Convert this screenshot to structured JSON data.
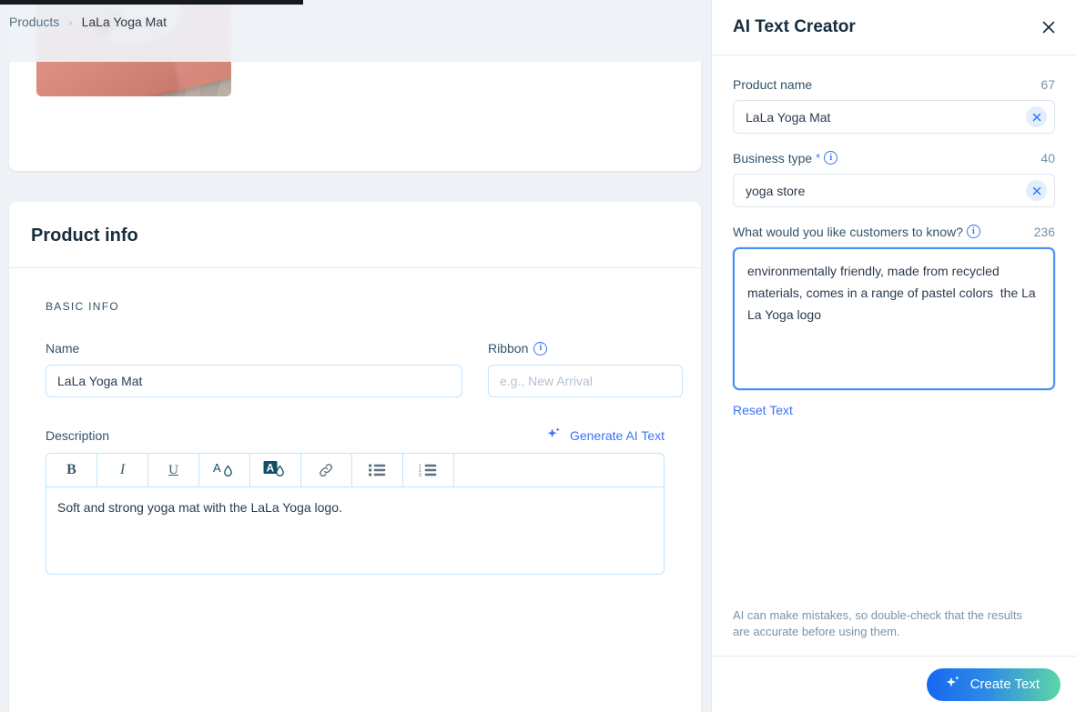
{
  "breadcrumb": {
    "parent": "Products",
    "separator": "›",
    "current": "LaLa Yoga Mat"
  },
  "product_card": {
    "title": "Product info",
    "section_label": "BASIC INFO",
    "name_field": {
      "label": "Name",
      "value": "LaLa Yoga Mat"
    },
    "ribbon_field": {
      "label": "Ribbon",
      "value": "",
      "placeholder": "e.g., New Arrival",
      "info_icon": "info-icon"
    },
    "description": {
      "label": "Description",
      "generate_link": "Generate AI Text",
      "generate_icon": "sparkle-icon",
      "body": "Soft and strong yoga mat with the LaLa Yoga logo.",
      "toolbar": [
        {
          "name": "bold",
          "label": "B"
        },
        {
          "name": "italic",
          "label": "I"
        },
        {
          "name": "underline",
          "label": "U"
        },
        {
          "name": "text-color",
          "label": ""
        },
        {
          "name": "text-highlight",
          "label": ""
        },
        {
          "name": "link",
          "label": ""
        },
        {
          "name": "bulleted-list",
          "label": ""
        },
        {
          "name": "numbered-list",
          "label": ""
        }
      ]
    }
  },
  "panel": {
    "title": "AI Text Creator",
    "close_icon": "close-icon",
    "product_name": {
      "label": "Product name",
      "count": "67",
      "value": "LaLa Yoga Mat",
      "clear_icon": "close-icon"
    },
    "business_type": {
      "label": "Business type",
      "required_marker": "*",
      "info_icon": "info-icon",
      "count": "40",
      "value": "yoga store",
      "clear_icon": "close-icon"
    },
    "prompt": {
      "label": "What would you like customers to know?",
      "info_icon": "info-icon",
      "count": "236",
      "value": "environmentally friendly, made from recycled materials, comes in a range of pastel colors  the La La Yoga logo",
      "reset_label": "Reset Text"
    },
    "disclaimer": "AI can make mistakes, so double-check that the results are accurate before using them.",
    "create_button": {
      "label": "Create Text",
      "icon": "sparkle-icon"
    }
  },
  "colors": {
    "accent_blue": "#3b73f5",
    "focus_blue": "#4a90f0",
    "icon_teal": "#0e4f66",
    "text_dark": "#162d3d",
    "text_muted": "#32536a",
    "button_gradient_start": "#1668f0",
    "button_gradient_end": "#5ed6a5",
    "page_bg": "#eef1f5"
  }
}
